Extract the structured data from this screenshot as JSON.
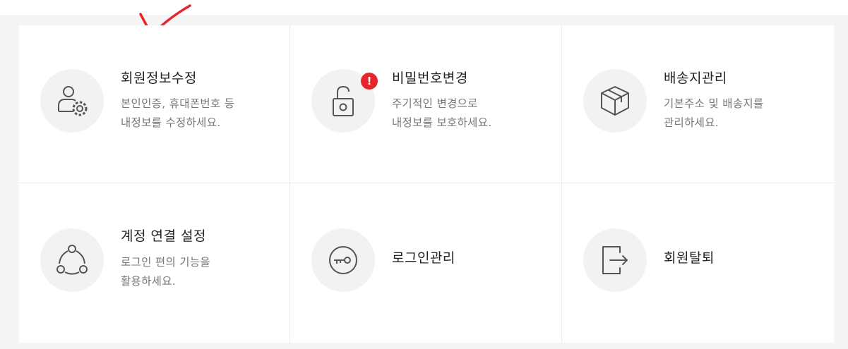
{
  "menu": [
    {
      "title": "회원정보수정",
      "desc": [
        "본인인증, 휴대폰번호 등",
        "내정보를 수정하세요."
      ],
      "icon": "user-gear-icon"
    },
    {
      "title": "비밀번호변경",
      "desc": [
        "주기적인 변경으로",
        "내정보를 보호하세요."
      ],
      "icon": "unlock-icon",
      "badge": "!"
    },
    {
      "title": "배송지관리",
      "desc": [
        "기본주소 및 배송지를",
        "관리하세요."
      ],
      "icon": "box-icon"
    },
    {
      "title": "계정 연결 설정",
      "desc": [
        "로그인 편의 기능을",
        "활용하세요."
      ],
      "icon": "link-nodes-icon"
    },
    {
      "title": "로그인관리",
      "icon": "key-icon"
    },
    {
      "title": "회원탈퇴",
      "icon": "exit-icon"
    }
  ],
  "colors": {
    "badge": "#e5262c",
    "annotation": "#e5262c",
    "icon": "#555555"
  }
}
